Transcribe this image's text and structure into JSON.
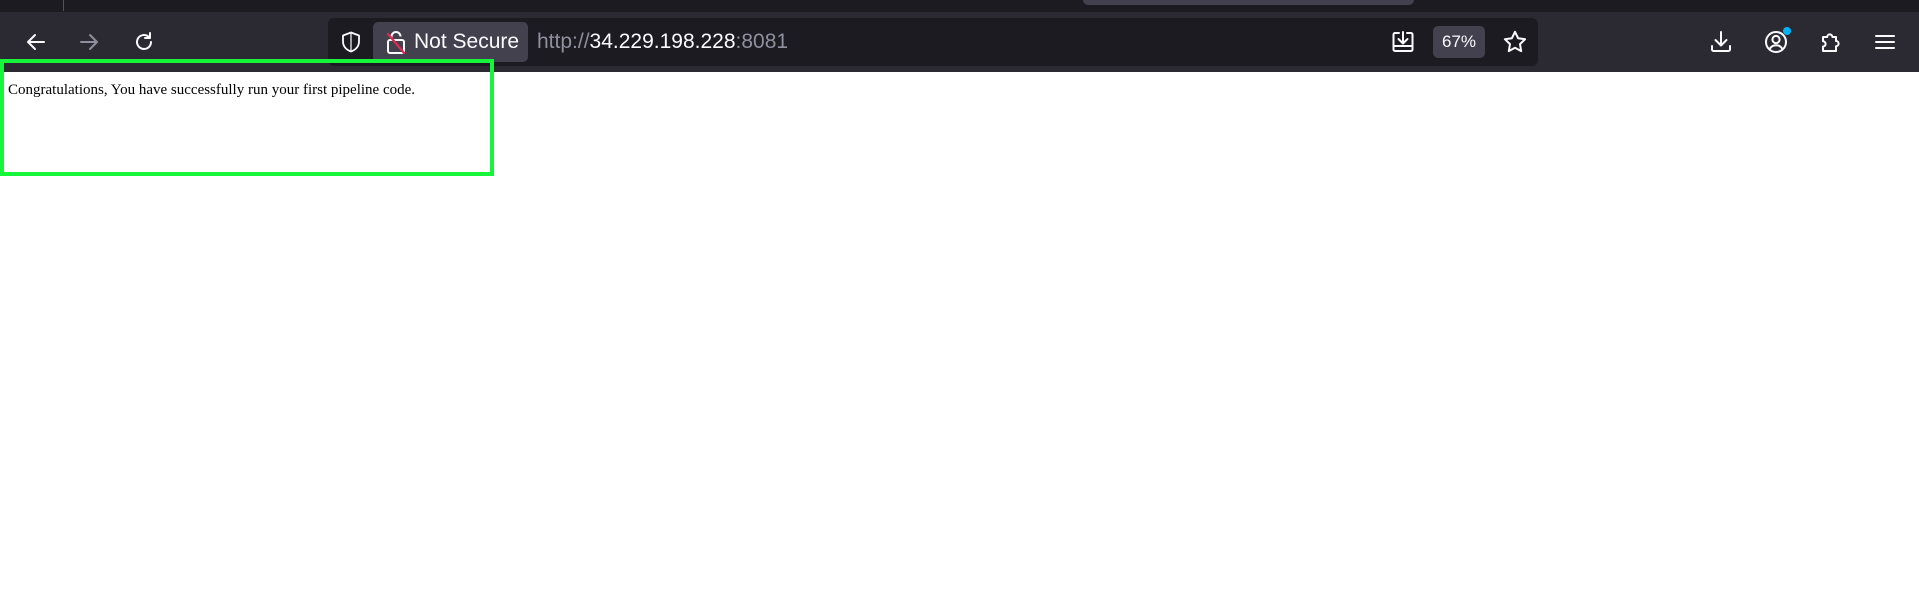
{
  "browser": {
    "url": {
      "scheme": "http://",
      "host": "34.229.198.228",
      "port": ":8081"
    },
    "identity_label": "Not Secure",
    "zoom_label": "67%",
    "colors": {
      "toolbar": "#2b2a33",
      "urlbar": "#1c1b22",
      "identity_box": "#42414d",
      "insecure_lock_slash": "#e22850",
      "account_badge": "#00b3f4"
    },
    "icons": {
      "back": "arrow-left-icon",
      "forward": "arrow-right-icon",
      "reload": "reload-icon",
      "tracking_protection": "shield-icon",
      "insecure_lock": "lock-crossed-icon",
      "save_to_pocket": "save-download-icon",
      "bookmark": "star-icon",
      "downloads": "download-icon",
      "account": "account-icon",
      "extensions": "puzzle-icon",
      "menu": "hamburger-menu-icon"
    }
  },
  "page": {
    "message": "Congratulations, You have successfully run your first pipeline code.",
    "highlight_color": "#17f53b"
  }
}
